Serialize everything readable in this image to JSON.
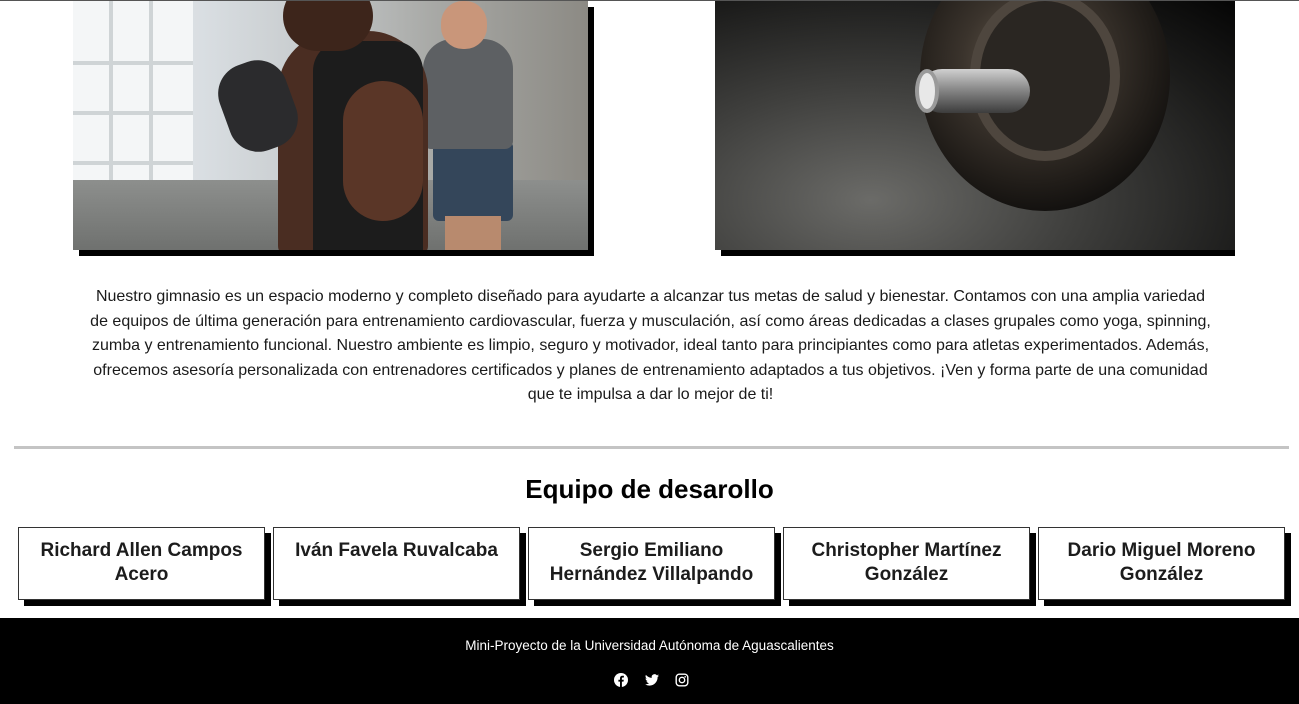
{
  "about": {
    "description": "Nuestro gimnasio es un espacio moderno y completo diseñado para ayudarte a alcanzar tus metas de salud y bienestar. Contamos con una amplia variedad de equipos de última generación para entrenamiento cardiovascular, fuerza y musculación, así como áreas dedicadas a clases grupales como yoga, spinning, zumba y entrenamiento funcional. Nuestro ambiente es limpio, seguro y motivador, ideal tanto para principiantes como para atletas experimentados. Además, ofrecemos asesoría personalizada con entrenadores certificados y planes de entrenamiento adaptados a tus objetivos. ¡Ven y forma parte de una comunidad que te impulsa a dar lo mejor de ti!"
  },
  "team": {
    "title": "Equipo de desarollo",
    "members": [
      "Richard Allen Campos Acero",
      "Iván Favela Ruvalcaba",
      "Sergio Emiliano Hernández Villalpando",
      "Christopher Martínez González",
      "Dario Miguel Moreno González"
    ]
  },
  "footer": {
    "text": "Mini-Proyecto de la Universidad Autónoma de Aguascalientes",
    "social_icons": [
      "facebook-icon",
      "twitter-icon",
      "instagram-icon"
    ]
  },
  "colors": {
    "footer_bg": "#000000",
    "card_shadow": "#000000",
    "divider": "#c4c4c4"
  }
}
